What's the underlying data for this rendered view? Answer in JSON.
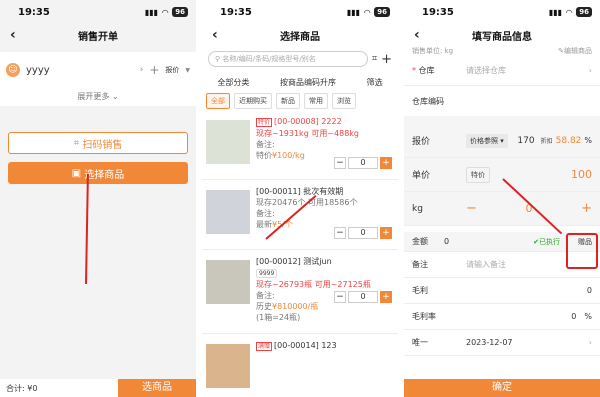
{
  "status": {
    "time": "19:35",
    "battery": "96"
  },
  "p1": {
    "title": "销售开单",
    "customer": "yyyy",
    "price_mode": "报价",
    "expand": "展开更多",
    "scan_btn": "扫码销售",
    "select_btn": "选择商品",
    "total": "合计: ¥0",
    "footer_btn": "选商品"
  },
  "p2": {
    "title": "选择商品",
    "search_placeholder": "名称/编码/条码/规格型号/别名",
    "filters": [
      "全部分类",
      "按商品编码升序",
      "筛选"
    ],
    "tabs": [
      "全部",
      "近期购买",
      "新品",
      "常用",
      "浏览"
    ],
    "items": [
      {
        "code": "[00-00008] 2222",
        "tag": "特价",
        "stock": "现存~1931kg",
        "avail": "可用~488kg",
        "note": "备注:",
        "price_label": "特价",
        "price": "¥100/kg",
        "qty": "0"
      },
      {
        "code": "[00-00011] 批次有效期",
        "stock": "现存20476个",
        "avail": "可用18586个",
        "note": "备注:",
        "price_label": "最新",
        "price": "¥5/个",
        "qty": "0"
      },
      {
        "code": "[00-00012] 测试jun",
        "badge": "9999",
        "stock": "现存~26793瓶",
        "avail": "可用~27125瓶",
        "note": "备注:",
        "price_label": "历史",
        "price": "¥810000/瓶",
        "sub": "(1箱=24瓶)",
        "qty": "0"
      },
      {
        "code": "[00-00014] 123",
        "tag": "满赠",
        "qty": ""
      }
    ]
  },
  "p3": {
    "title": "填写商品信息",
    "unit_line": "销售单位: kg",
    "edit": "编辑商品",
    "warehouse_label": "仓库",
    "warehouse_ph": "请选择仓库",
    "warehouse_code": "仓库编码",
    "quote_label": "报价",
    "price_ref": "价格参照",
    "quote_value": "170",
    "discount_label": "折扣",
    "discount_value": "58.82",
    "pct": "%",
    "unit_price_label": "单价",
    "special": "特价",
    "unit_price": "100",
    "qty_label": "kg",
    "qty": "0",
    "amount_label": "金额",
    "amount": "0",
    "executed": "已执行",
    "gift": "赠品",
    "remark_label": "备注",
    "remark_ph": "请输入备注",
    "gp_label": "毛利",
    "gp": "0",
    "gpr_label": "毛利率",
    "gpr": "0",
    "gpr_unit": "%",
    "unique_label": "唯一",
    "date": "2023-12-07",
    "confirm": "确定"
  }
}
